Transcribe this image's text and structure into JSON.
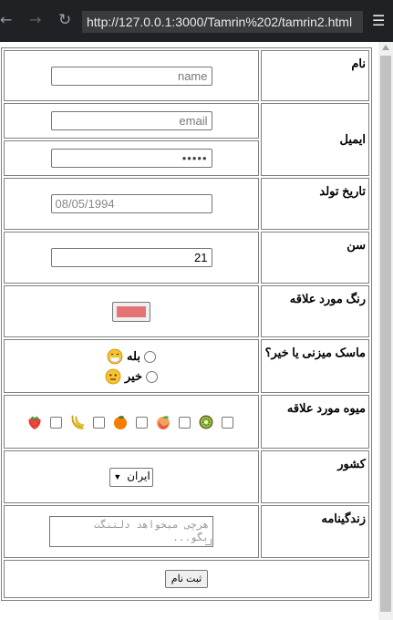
{
  "browser": {
    "back_icon": "arrow-left-icon",
    "forward_icon": "arrow-right-icon",
    "reload_icon": "reload-icon",
    "url": "http://127.0.0.1:3000/Tamrin%202/tamrin2.html",
    "menu_icon": "hamburger-menu-icon"
  },
  "form": {
    "name": {
      "label": "نام",
      "placeholder": "name"
    },
    "email": {
      "label": "ایمیل",
      "email_placeholder": "email",
      "password_dots": "•••••"
    },
    "birthdate": {
      "label": "تاریخ تولد",
      "value": "08/05/1994"
    },
    "age": {
      "label": "سن",
      "value": "21"
    },
    "color": {
      "label": "رنگ مورد علاقه",
      "value": "#e57373"
    },
    "mask": {
      "label": "ماسک میزنی یا خیر؟",
      "options": [
        {
          "label": "بله",
          "icon": "mask-face-icon"
        },
        {
          "label": "خیر",
          "icon": "neutral-face-icon"
        }
      ]
    },
    "fruits": {
      "label": "میوه مورد علاقه",
      "items": [
        {
          "icon": "kiwi-icon"
        },
        {
          "icon": "peach-icon"
        },
        {
          "icon": "tangerine-icon"
        },
        {
          "icon": "banana-icon"
        },
        {
          "icon": "strawberry-icon"
        }
      ]
    },
    "country": {
      "label": "کشور",
      "selected": "ایران"
    },
    "bio": {
      "label": "زندگینامه",
      "placeholder": "هرچی میخواهد دلتنگت بگو..."
    },
    "submit": {
      "label": "ثبت نام"
    }
  }
}
